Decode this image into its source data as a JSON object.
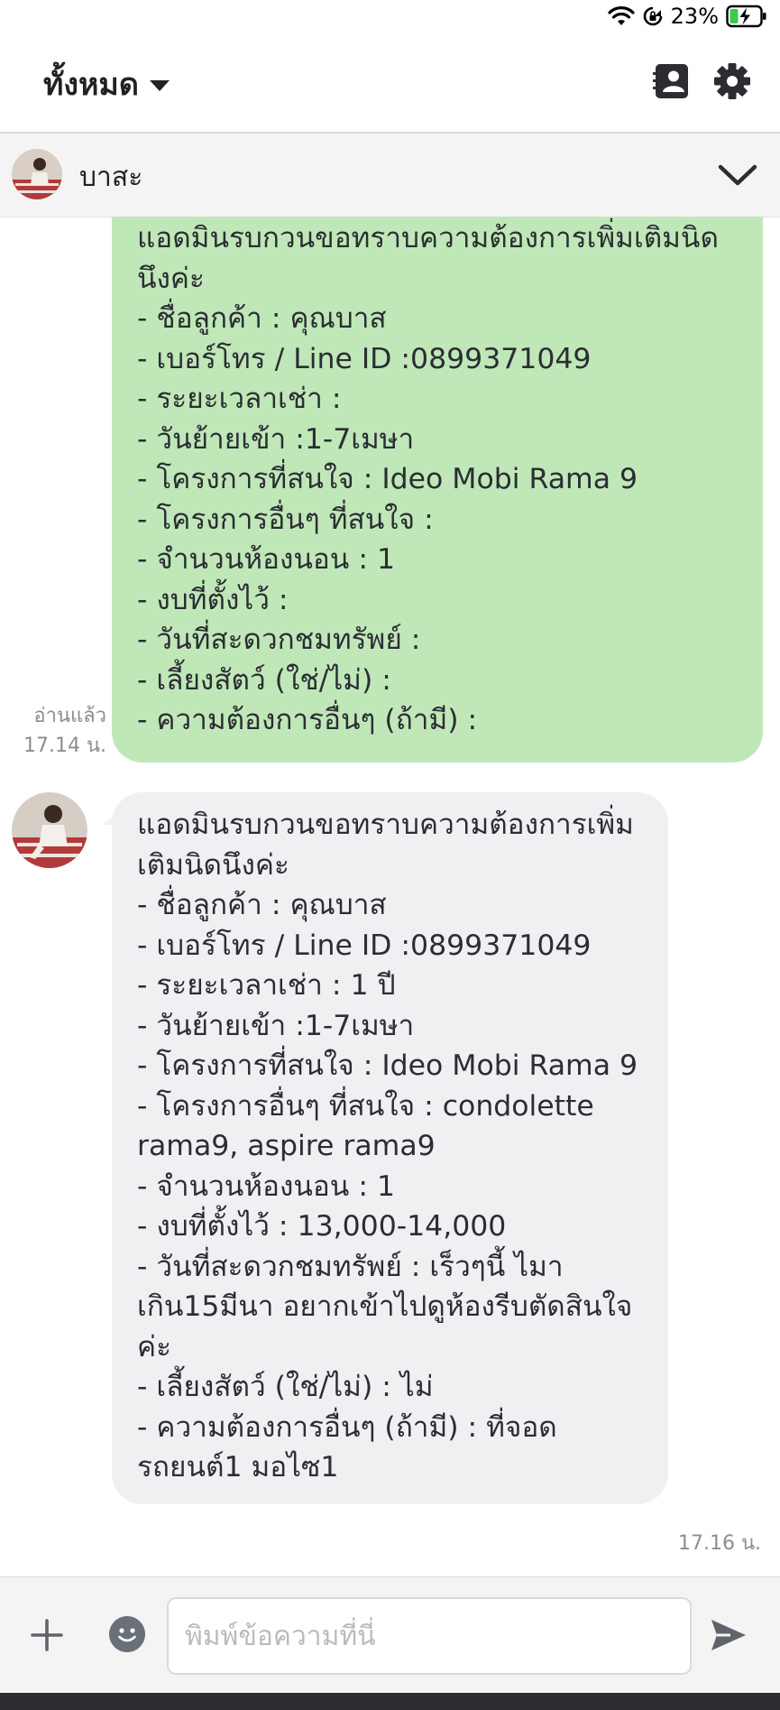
{
  "status_bar": {
    "battery_percent": "23%"
  },
  "header": {
    "filter_label": "ทั้งหมด",
    "icons": [
      "contact-card-icon",
      "gear-icon"
    ]
  },
  "chat": {
    "contact_name": "บาสะ",
    "icons": [
      "chevron-down-icon"
    ]
  },
  "messages": [
    {
      "direction": "outgoing",
      "text": "แอดมินรบกวนขอทราบความต้องการเพิ่มเติมนิดนึงค่ะ\n- ชื่อลูกค้า : คุณบาส\n- เบอร์โทร / Line ID :0899371049\n- ระยะเวลาเช่า :\n- วันย้ายเข้า :1-7เมษา\n- โครงการที่สนใจ : Ideo Mobi Rama 9\n- โครงการอื่นๆ ที่สนใจ :\n- จำนวนห้องนอน : 1\n- งบที่ตั้งไว้ :\n- วันที่สะดวกชมทรัพย์ :\n- เลี้ยงสัตว์ (ใช่/ไม่) :\n- ความต้องการอื่นๆ (ถ้ามี) :",
      "read_label": "อ่านแล้ว",
      "time": "17.14 น."
    },
    {
      "direction": "incoming",
      "text": "แอดมินรบกวนขอทราบความต้องการเพิ่มเติมนิดนึงค่ะ\n- ชื่อลูกค้า : คุณบาส\n- เบอร์โทร / Line ID :0899371049\n- ระยะเวลาเช่า : 1 ปี\n- วันย้ายเข้า :1-7เมษา\n- โครงการที่สนใจ : Ideo Mobi Rama 9\n- โครงการอื่นๆ ที่สนใจ : condolette rama9, aspire rama9\n- จำนวนห้องนอน : 1\n- งบที่ตั้งไว้ : 13,000-14,000\n- วันที่สะดวกชมทรัพย์ : เร็วๆนี้ ไมาเกิน15มีนา อยากเข้าไปดูห้องรีบตัดสินใจค่ะ\n- เลี้ยงสัตว์ (ใช่/ไม่) : ไม่\n- ความต้องการอื่นๆ (ถ้ามี) : ที่จอดรถยนต์1 มอไซ1",
      "time": "17.16 น."
    }
  ],
  "input": {
    "placeholder": "พิมพ์ข้อความที่นี่",
    "value": ""
  },
  "colors": {
    "outgoing_bubble": "#c0e7b8",
    "incoming_bubble": "#eff0f2",
    "icon_dark": "#2b2d33",
    "meta_text": "#8a8d93"
  }
}
